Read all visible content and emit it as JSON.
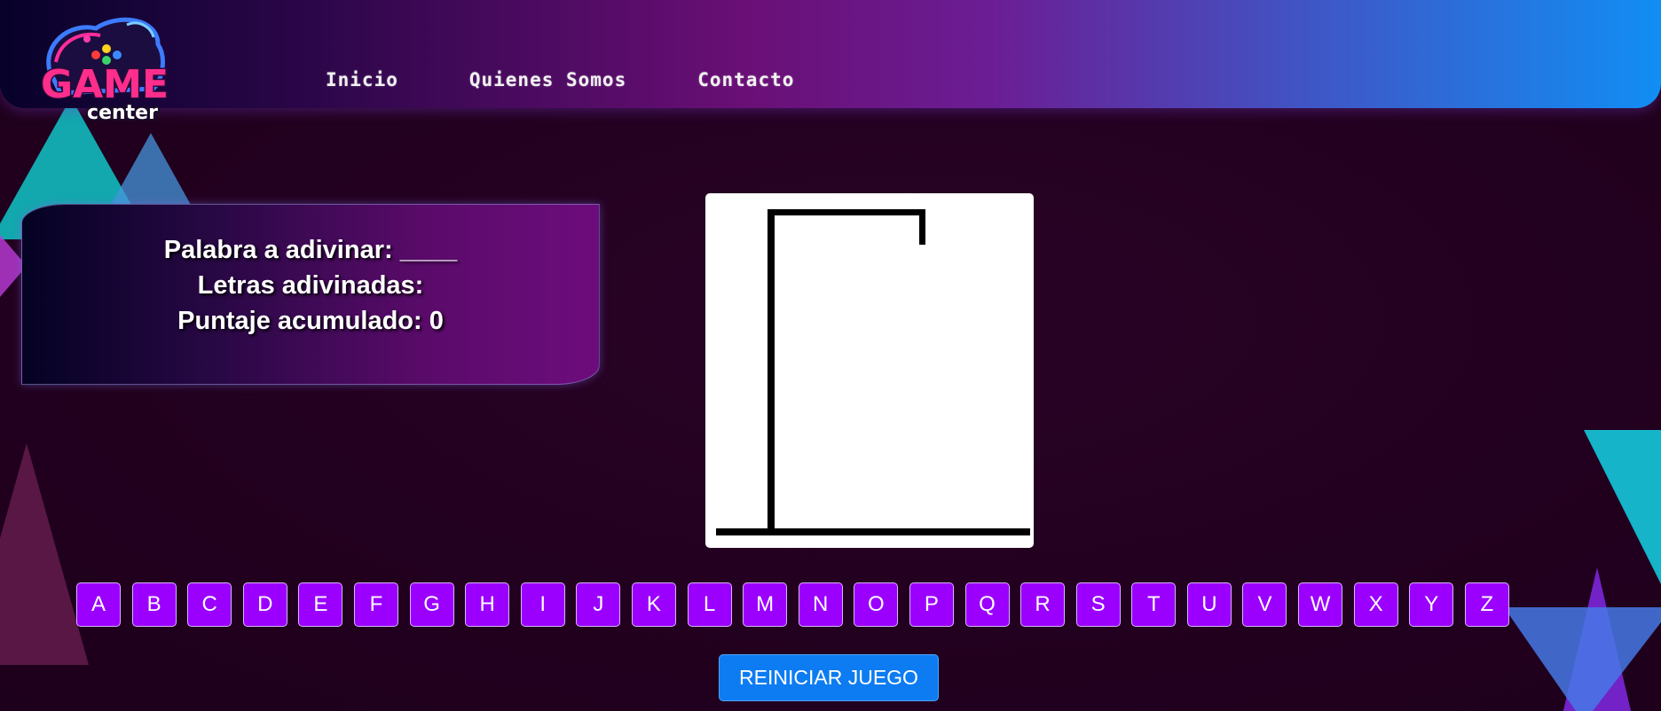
{
  "brand": {
    "logo_word": "GAME",
    "logo_sub": "center"
  },
  "nav": {
    "items": [
      {
        "label": "Inicio"
      },
      {
        "label": "Quienes Somos"
      },
      {
        "label": "Contacto"
      }
    ]
  },
  "game": {
    "word_label": "Palabra a adivinar: ____",
    "guessed_label": "Letras adivinadas:",
    "score_label": "Puntaje acumulado: 0"
  },
  "keyboard": {
    "letters": [
      "A",
      "B",
      "C",
      "D",
      "E",
      "F",
      "G",
      "H",
      "I",
      "J",
      "K",
      "L",
      "M",
      "N",
      "O",
      "P",
      "Q",
      "R",
      "S",
      "T",
      "U",
      "V",
      "W",
      "X",
      "Y",
      "Z"
    ]
  },
  "reset_label": "REINICIAR JUEGO",
  "colors": {
    "key_bg": "#9b00ff",
    "button_bg": "#0d7cf2",
    "page_bg": "#22001f"
  }
}
